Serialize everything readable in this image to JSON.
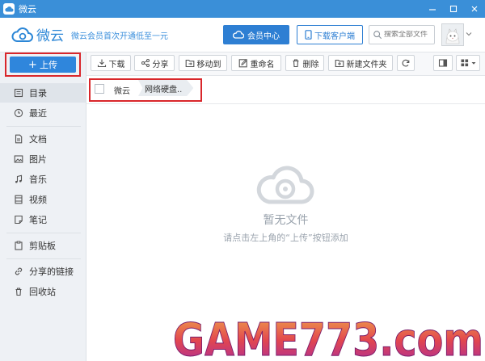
{
  "window": {
    "title": "微云"
  },
  "header": {
    "logo_text": "微云",
    "promo": "微云会员首次开通低至一元",
    "vip_label": "会员中心",
    "download_label": "下载客户端",
    "search_placeholder": "搜索全部文件"
  },
  "sidebar": {
    "upload_label": "上传",
    "items": [
      {
        "label": "目录",
        "icon": "directory-icon",
        "active": true
      },
      {
        "label": "最近",
        "icon": "clock-icon"
      },
      {
        "label": "文档",
        "icon": "document-icon"
      },
      {
        "label": "图片",
        "icon": "image-icon"
      },
      {
        "label": "音乐",
        "icon": "music-icon"
      },
      {
        "label": "视频",
        "icon": "video-icon"
      },
      {
        "label": "笔记",
        "icon": "note-icon"
      },
      {
        "label": "剪贴板",
        "icon": "clipboard-icon"
      },
      {
        "label": "分享的链接",
        "icon": "link-icon"
      },
      {
        "label": "回收站",
        "icon": "trash-icon"
      }
    ]
  },
  "toolbar": {
    "download": "下载",
    "share": "分享",
    "move": "移动到",
    "rename": "重命名",
    "delete": "删除",
    "new_folder": "新建文件夹"
  },
  "breadcrumb": {
    "root": "微云",
    "current": "网络硬盘.."
  },
  "empty": {
    "title": "暂无文件",
    "hint": "请点击左上角的“上传”按钮添加"
  },
  "watermark": {
    "text": "GAME773.com"
  },
  "colors": {
    "accent": "#2e7fd3",
    "highlight": "#d9262b",
    "titlebar": "#3a8fd8"
  }
}
